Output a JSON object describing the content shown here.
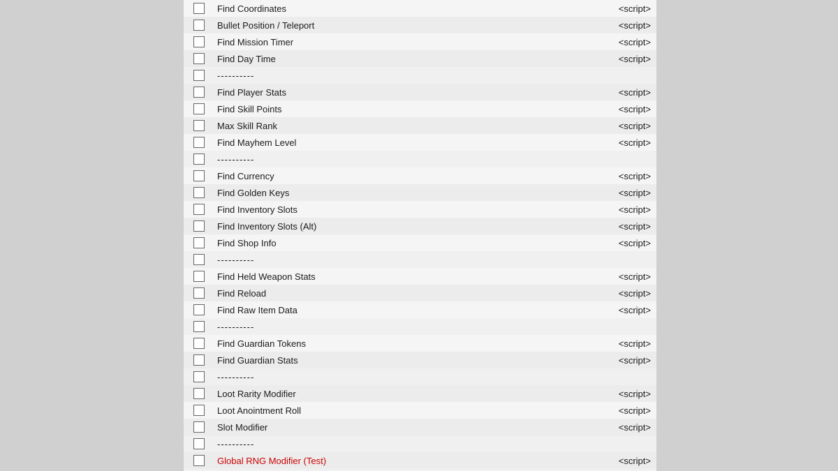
{
  "items": [
    {
      "id": "find-coordinates",
      "label": "Find Coordinates",
      "script": "<script>",
      "type": "item",
      "color": "normal"
    },
    {
      "id": "bullet-position",
      "label": "Bullet Position / Teleport",
      "script": "<script>",
      "type": "item",
      "color": "normal"
    },
    {
      "id": "find-mission-timer",
      "label": "Find Mission Timer",
      "script": "<script>",
      "type": "item",
      "color": "normal"
    },
    {
      "id": "find-day-time",
      "label": "Find Day Time",
      "script": "<script>",
      "type": "item",
      "color": "normal"
    },
    {
      "id": "sep1",
      "label": "----------",
      "script": "",
      "type": "separator",
      "color": "normal"
    },
    {
      "id": "find-player-stats",
      "label": "Find Player Stats",
      "script": "<script>",
      "type": "item",
      "color": "normal"
    },
    {
      "id": "find-skill-points",
      "label": "Find Skill Points",
      "script": "<script>",
      "type": "item",
      "color": "normal"
    },
    {
      "id": "max-skill-rank",
      "label": "Max Skill Rank",
      "script": "<script>",
      "type": "item",
      "color": "normal"
    },
    {
      "id": "find-mayhem-level",
      "label": "Find Mayhem Level",
      "script": "<script>",
      "type": "item",
      "color": "normal"
    },
    {
      "id": "sep2",
      "label": "----------",
      "script": "",
      "type": "separator",
      "color": "normal"
    },
    {
      "id": "find-currency",
      "label": "Find Currency",
      "script": "<script>",
      "type": "item",
      "color": "normal"
    },
    {
      "id": "find-golden-keys",
      "label": "Find Golden Keys",
      "script": "<script>",
      "type": "item",
      "color": "normal"
    },
    {
      "id": "find-inventory-slots",
      "label": "Find Inventory Slots",
      "script": "<script>",
      "type": "item",
      "color": "normal"
    },
    {
      "id": "find-inventory-slots-alt",
      "label": "Find Inventory Slots (Alt)",
      "script": "<script>",
      "type": "item",
      "color": "normal"
    },
    {
      "id": "find-shop-info",
      "label": "Find Shop Info",
      "script": "<script>",
      "type": "item",
      "color": "normal"
    },
    {
      "id": "sep3",
      "label": "----------",
      "script": "",
      "type": "separator",
      "color": "normal"
    },
    {
      "id": "find-held-weapon-stats",
      "label": "Find Held Weapon Stats",
      "script": "<script>",
      "type": "item",
      "color": "normal"
    },
    {
      "id": "find-reload",
      "label": "Find Reload",
      "script": "<script>",
      "type": "item",
      "color": "normal"
    },
    {
      "id": "find-raw-item-data",
      "label": "Find Raw Item Data",
      "script": "<script>",
      "type": "item",
      "color": "normal"
    },
    {
      "id": "sep4",
      "label": "----------",
      "script": "",
      "type": "separator",
      "color": "normal"
    },
    {
      "id": "find-guardian-tokens",
      "label": "Find Guardian Tokens",
      "script": "<script>",
      "type": "item",
      "color": "normal"
    },
    {
      "id": "find-guardian-stats",
      "label": "Find Guardian Stats",
      "script": "<script>",
      "type": "item",
      "color": "normal"
    },
    {
      "id": "sep5",
      "label": "----------",
      "script": "",
      "type": "separator",
      "color": "normal"
    },
    {
      "id": "loot-rarity-modifier",
      "label": "Loot Rarity Modifier",
      "script": "<script>",
      "type": "item",
      "color": "normal"
    },
    {
      "id": "loot-anointment-roll",
      "label": "Loot Anointment Roll",
      "script": "<script>",
      "type": "item",
      "color": "normal"
    },
    {
      "id": "slot-modifier",
      "label": "Slot Modifier",
      "script": "<script>",
      "type": "item",
      "color": "normal"
    },
    {
      "id": "sep6",
      "label": "----------",
      "script": "",
      "type": "separator",
      "color": "normal"
    },
    {
      "id": "global-rng-modifier",
      "label": "Global RNG Modifier (Test)",
      "script": "<script>",
      "type": "item",
      "color": "red"
    }
  ]
}
